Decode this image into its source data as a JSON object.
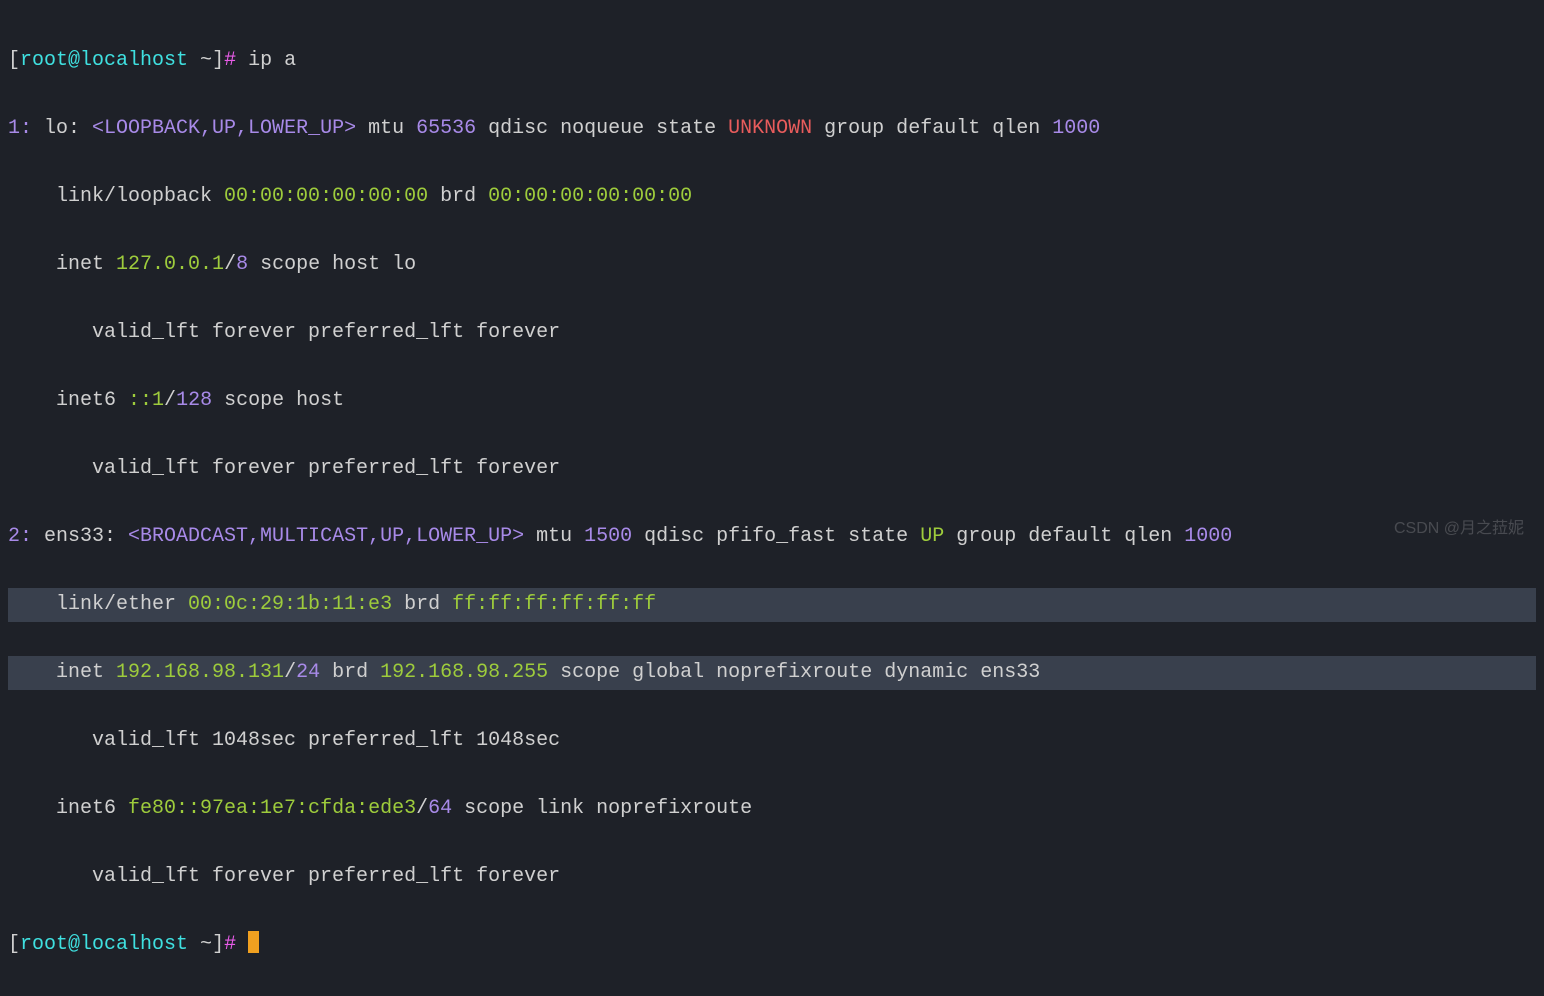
{
  "prompt": {
    "open": "[",
    "user": "root@localhost",
    "dir": " ~",
    "close": "]",
    "hash": "# ",
    "cmd": "ip a"
  },
  "if1": {
    "idx": "1:",
    "name": " lo: ",
    "flags": "<LOOPBACK,UP,LOWER_UP>",
    "mtu_lbl": " mtu ",
    "mtu": "65536",
    "qdisc": " qdisc noqueue state ",
    "state": "UNKNOWN",
    "tail": " group default qlen ",
    "qlen": "1000",
    "link_pre": "    link/loopback ",
    "mac": "00:00:00:00:00:00",
    "brd_lbl": " brd ",
    "brd": "00:00:00:00:00:00",
    "inet_pre": "    inet ",
    "inet": "127.0.0.1",
    "slash": "/",
    "pfx": "8",
    "inet_tail": " scope host lo",
    "lft1": "       valid_lft forever preferred_lft forever",
    "inet6_pre": "    inet6 ",
    "inet6": "::1",
    "pfx6": "128",
    "inet6_tail": " scope host ",
    "lft2": "       valid_lft forever preferred_lft forever"
  },
  "if2": {
    "idx": "2:",
    "name": " ens33: ",
    "flags": "<BROADCAST,MULTICAST,UP,LOWER_UP>",
    "mtu_lbl": " mtu ",
    "mtu": "1500",
    "qdisc": " qdisc pfifo_fast state ",
    "state": "UP",
    "tail": " group default qlen ",
    "qlen": "1000",
    "link_pre": "    link/ether ",
    "mac": "00:0c:29:1b:11:e3",
    "brd_lbl": " brd ",
    "brd": "ff:ff:ff:ff:ff:ff",
    "inet_pre": "    inet ",
    "inet": "192.168.98.131",
    "slash": "/",
    "pfx": "24",
    "brd2_lbl": " brd ",
    "brd2": "192.168.98.255",
    "inet_tail": " scope global noprefixroute dynamic ens33",
    "lft1": "       valid_lft 1048sec preferred_lft 1048sec",
    "inet6_pre": "    inet6 ",
    "inet6": "fe80::97ea:1e7:cfda:ede3",
    "pfx6": "64",
    "inet6_tail": " scope link noprefixroute ",
    "lft2": "       valid_lft forever preferred_lft forever"
  },
  "watermark": "CSDN @月之菈妮"
}
